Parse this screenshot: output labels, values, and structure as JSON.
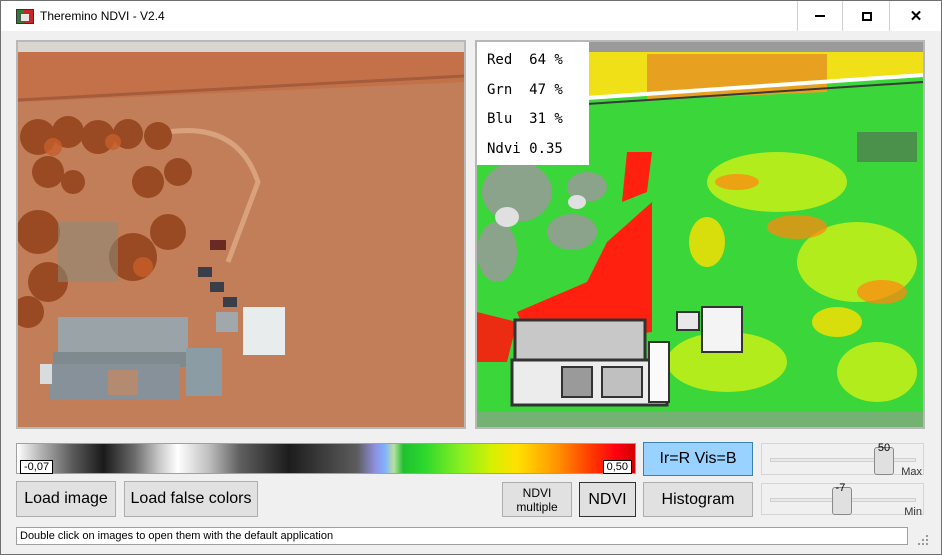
{
  "window": {
    "title": "Theremino NDVI - V2.4",
    "icon": "theremino-app-icon",
    "controls": [
      "minimize-icon",
      "maximize-icon",
      "close-icon"
    ],
    "close_hover_color": "#e81123"
  },
  "info_box": {
    "red": "Red  64 %",
    "green": "Grn  47 %",
    "blue": "Blu  31 %",
    "ndvi": "Ndvi 0.35"
  },
  "palette": {
    "min_label": "-0,07",
    "max_label": "0,50"
  },
  "buttons": {
    "load_image": "Load image",
    "load_false_colors": "Load false colors",
    "ndvi_multiple_line1": "NDVI",
    "ndvi_multiple_line2": "multiple",
    "ndvi": "NDVI",
    "ir_vis": "Ir=R Vis=B",
    "histogram": "Histogram"
  },
  "sliders": {
    "max": {
      "value": "50",
      "label": "Max",
      "level": 0.78
    },
    "min": {
      "value": "-7",
      "label": "Min",
      "level": 0.49
    }
  },
  "status_bar": {
    "text": "Double click on images to open them with the default application"
  },
  "colors": {
    "accent_button": "#99d1ff",
    "palette_high": "#ff0010",
    "palette_mid": "#2dd82d"
  }
}
